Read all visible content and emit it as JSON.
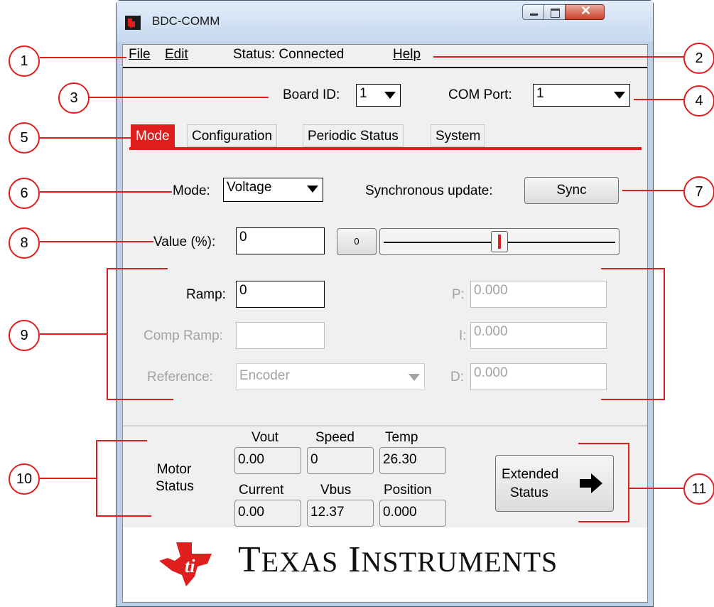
{
  "window": {
    "title": "BDC-COMM"
  },
  "menu": {
    "file": "File",
    "edit": "Edit",
    "status": "Status: Connected",
    "help": "Help"
  },
  "board_id": {
    "label": "Board ID:",
    "value": "1"
  },
  "com_port": {
    "label": "COM Port:",
    "value": "1"
  },
  "tabs": [
    {
      "label": "Mode",
      "active": true
    },
    {
      "label": "Configuration"
    },
    {
      "label": "Periodic Status"
    },
    {
      "label": "System"
    }
  ],
  "mode": {
    "label": "Mode:",
    "value": "Voltage"
  },
  "sync": {
    "label": "Synchronous update:",
    "button": "Sync"
  },
  "value_field": {
    "label": "Value (%):",
    "value": "0",
    "slider_button": "0",
    "slider_fraction": 0.5
  },
  "ramp": {
    "label": "Ramp:",
    "value": "0"
  },
  "comp_ramp": {
    "label": "Comp Ramp:",
    "value": ""
  },
  "reference": {
    "label": "Reference:",
    "value": "Encoder"
  },
  "pid": {
    "p": {
      "label": "P:",
      "value": "0.000"
    },
    "i": {
      "label": "I:",
      "value": "0.000"
    },
    "d": {
      "label": "D:",
      "value": "0.000"
    }
  },
  "motor_status": {
    "title_line1": "Motor",
    "title_line2": "Status",
    "vout": {
      "label": "Vout",
      "value": "0.00"
    },
    "speed": {
      "label": "Speed",
      "value": "0"
    },
    "temp": {
      "label": "Temp",
      "value": "26.30"
    },
    "current": {
      "label": "Current",
      "value": "0.00"
    },
    "vbus": {
      "label": "Vbus",
      "value": "12.37"
    },
    "position": {
      "label": "Position",
      "value": "0.000"
    }
  },
  "extended_status": {
    "line1": "Extended",
    "line2": "Status"
  },
  "logo": {
    "brand": "Texas Instruments",
    "icon": "texas-instruments-logo"
  },
  "callouts": [
    "1",
    "2",
    "3",
    "4",
    "5",
    "6",
    "7",
    "8",
    "9",
    "10",
    "11"
  ],
  "colors": {
    "accent": "#e01e1e",
    "panel": "#f0f0f0",
    "disabled_text": "#a3a3a3"
  }
}
